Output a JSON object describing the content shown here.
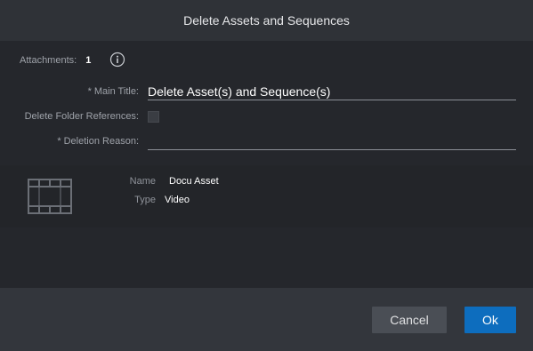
{
  "dialog": {
    "title": "Delete Assets and Sequences"
  },
  "attachments": {
    "label": "Attachments:",
    "count": "1",
    "info_icon": "info-icon"
  },
  "form": {
    "main_title": {
      "required_marker": "*",
      "label": "Main Title:",
      "value": "Delete Asset(s) and Sequence(s)"
    },
    "delete_folder_references": {
      "label": "Delete Folder References:",
      "checked": false
    },
    "deletion_reason": {
      "required_marker": "*",
      "label": "Deletion Reason:",
      "value": ""
    }
  },
  "asset": {
    "icon": "film-icon",
    "name_label": "Name",
    "name_value": "Docu Asset",
    "type_label": "Type",
    "type_value": "Video"
  },
  "footer": {
    "cancel_label": "Cancel",
    "ok_label": "Ok"
  },
  "colors": {
    "accent": "#0d6dbe",
    "background": "#25272c",
    "header": "#2f3237",
    "footer": "#33363c"
  }
}
